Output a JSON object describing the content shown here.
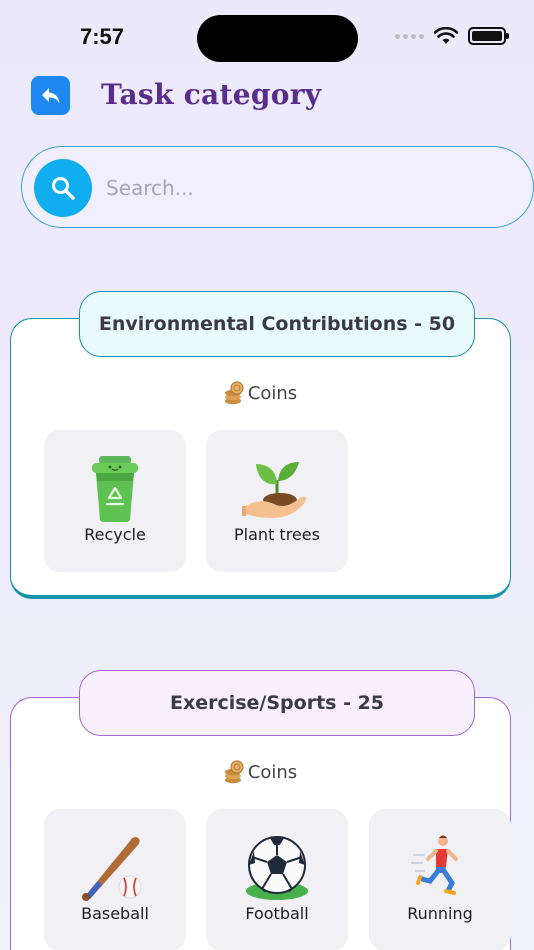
{
  "status": {
    "time": "7:57"
  },
  "header": {
    "title": "Task category"
  },
  "search": {
    "placeholder": "Search..."
  },
  "categories": [
    {
      "title": "Environmental Contributions - 50",
      "coins_label": "Coins",
      "accent": "#1693ad",
      "items": [
        {
          "label": "Recycle",
          "icon": "recycle-bin-icon"
        },
        {
          "label": "Plant trees",
          "icon": "plant-in-hand-icon"
        }
      ]
    },
    {
      "title": "Exercise/Sports - 25",
      "coins_label": "Coins",
      "accent": "#a565d8",
      "items": [
        {
          "label": "Baseball",
          "icon": "baseball-icon"
        },
        {
          "label": "Football",
          "icon": "soccer-ball-icon"
        },
        {
          "label": "Running",
          "icon": "runner-icon"
        }
      ]
    }
  ],
  "colors": {
    "back_button": "#1e88f0",
    "search_button": "#10aeee",
    "title": "#5a2d8c"
  }
}
